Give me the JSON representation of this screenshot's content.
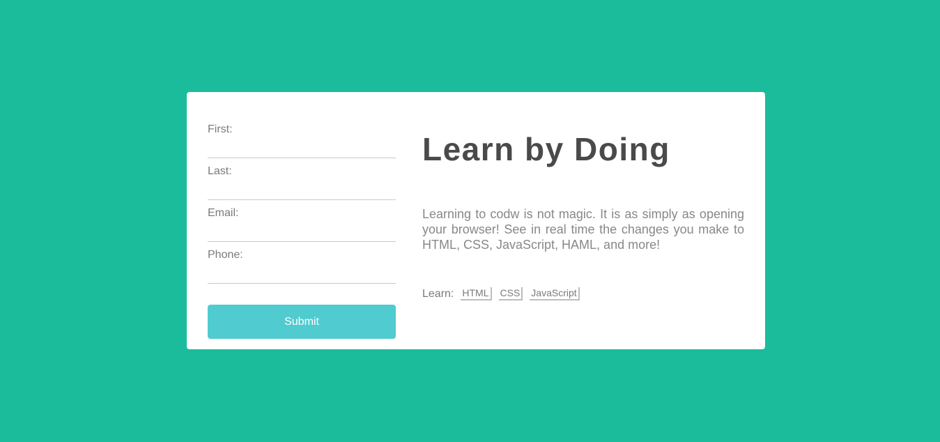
{
  "form": {
    "fields": [
      {
        "label": "First:",
        "value": ""
      },
      {
        "label": "Last:",
        "value": ""
      },
      {
        "label": "Email:",
        "value": ""
      },
      {
        "label": "Phone:",
        "value": ""
      }
    ],
    "submit_label": "Submit"
  },
  "info": {
    "title": "Learn by Doing",
    "body": "Learning to codw is not magic. It is as simply as opening your browser! See in real time the changes you make to HTML, CSS, JavaScript, HAML, and more!",
    "learn_label": "Learn:",
    "tags": [
      "HTML",
      "CSS",
      "JavaScript"
    ]
  },
  "colors": {
    "background": "#1bbc9b",
    "button": "#50cbcf",
    "card": "#ffffff"
  }
}
